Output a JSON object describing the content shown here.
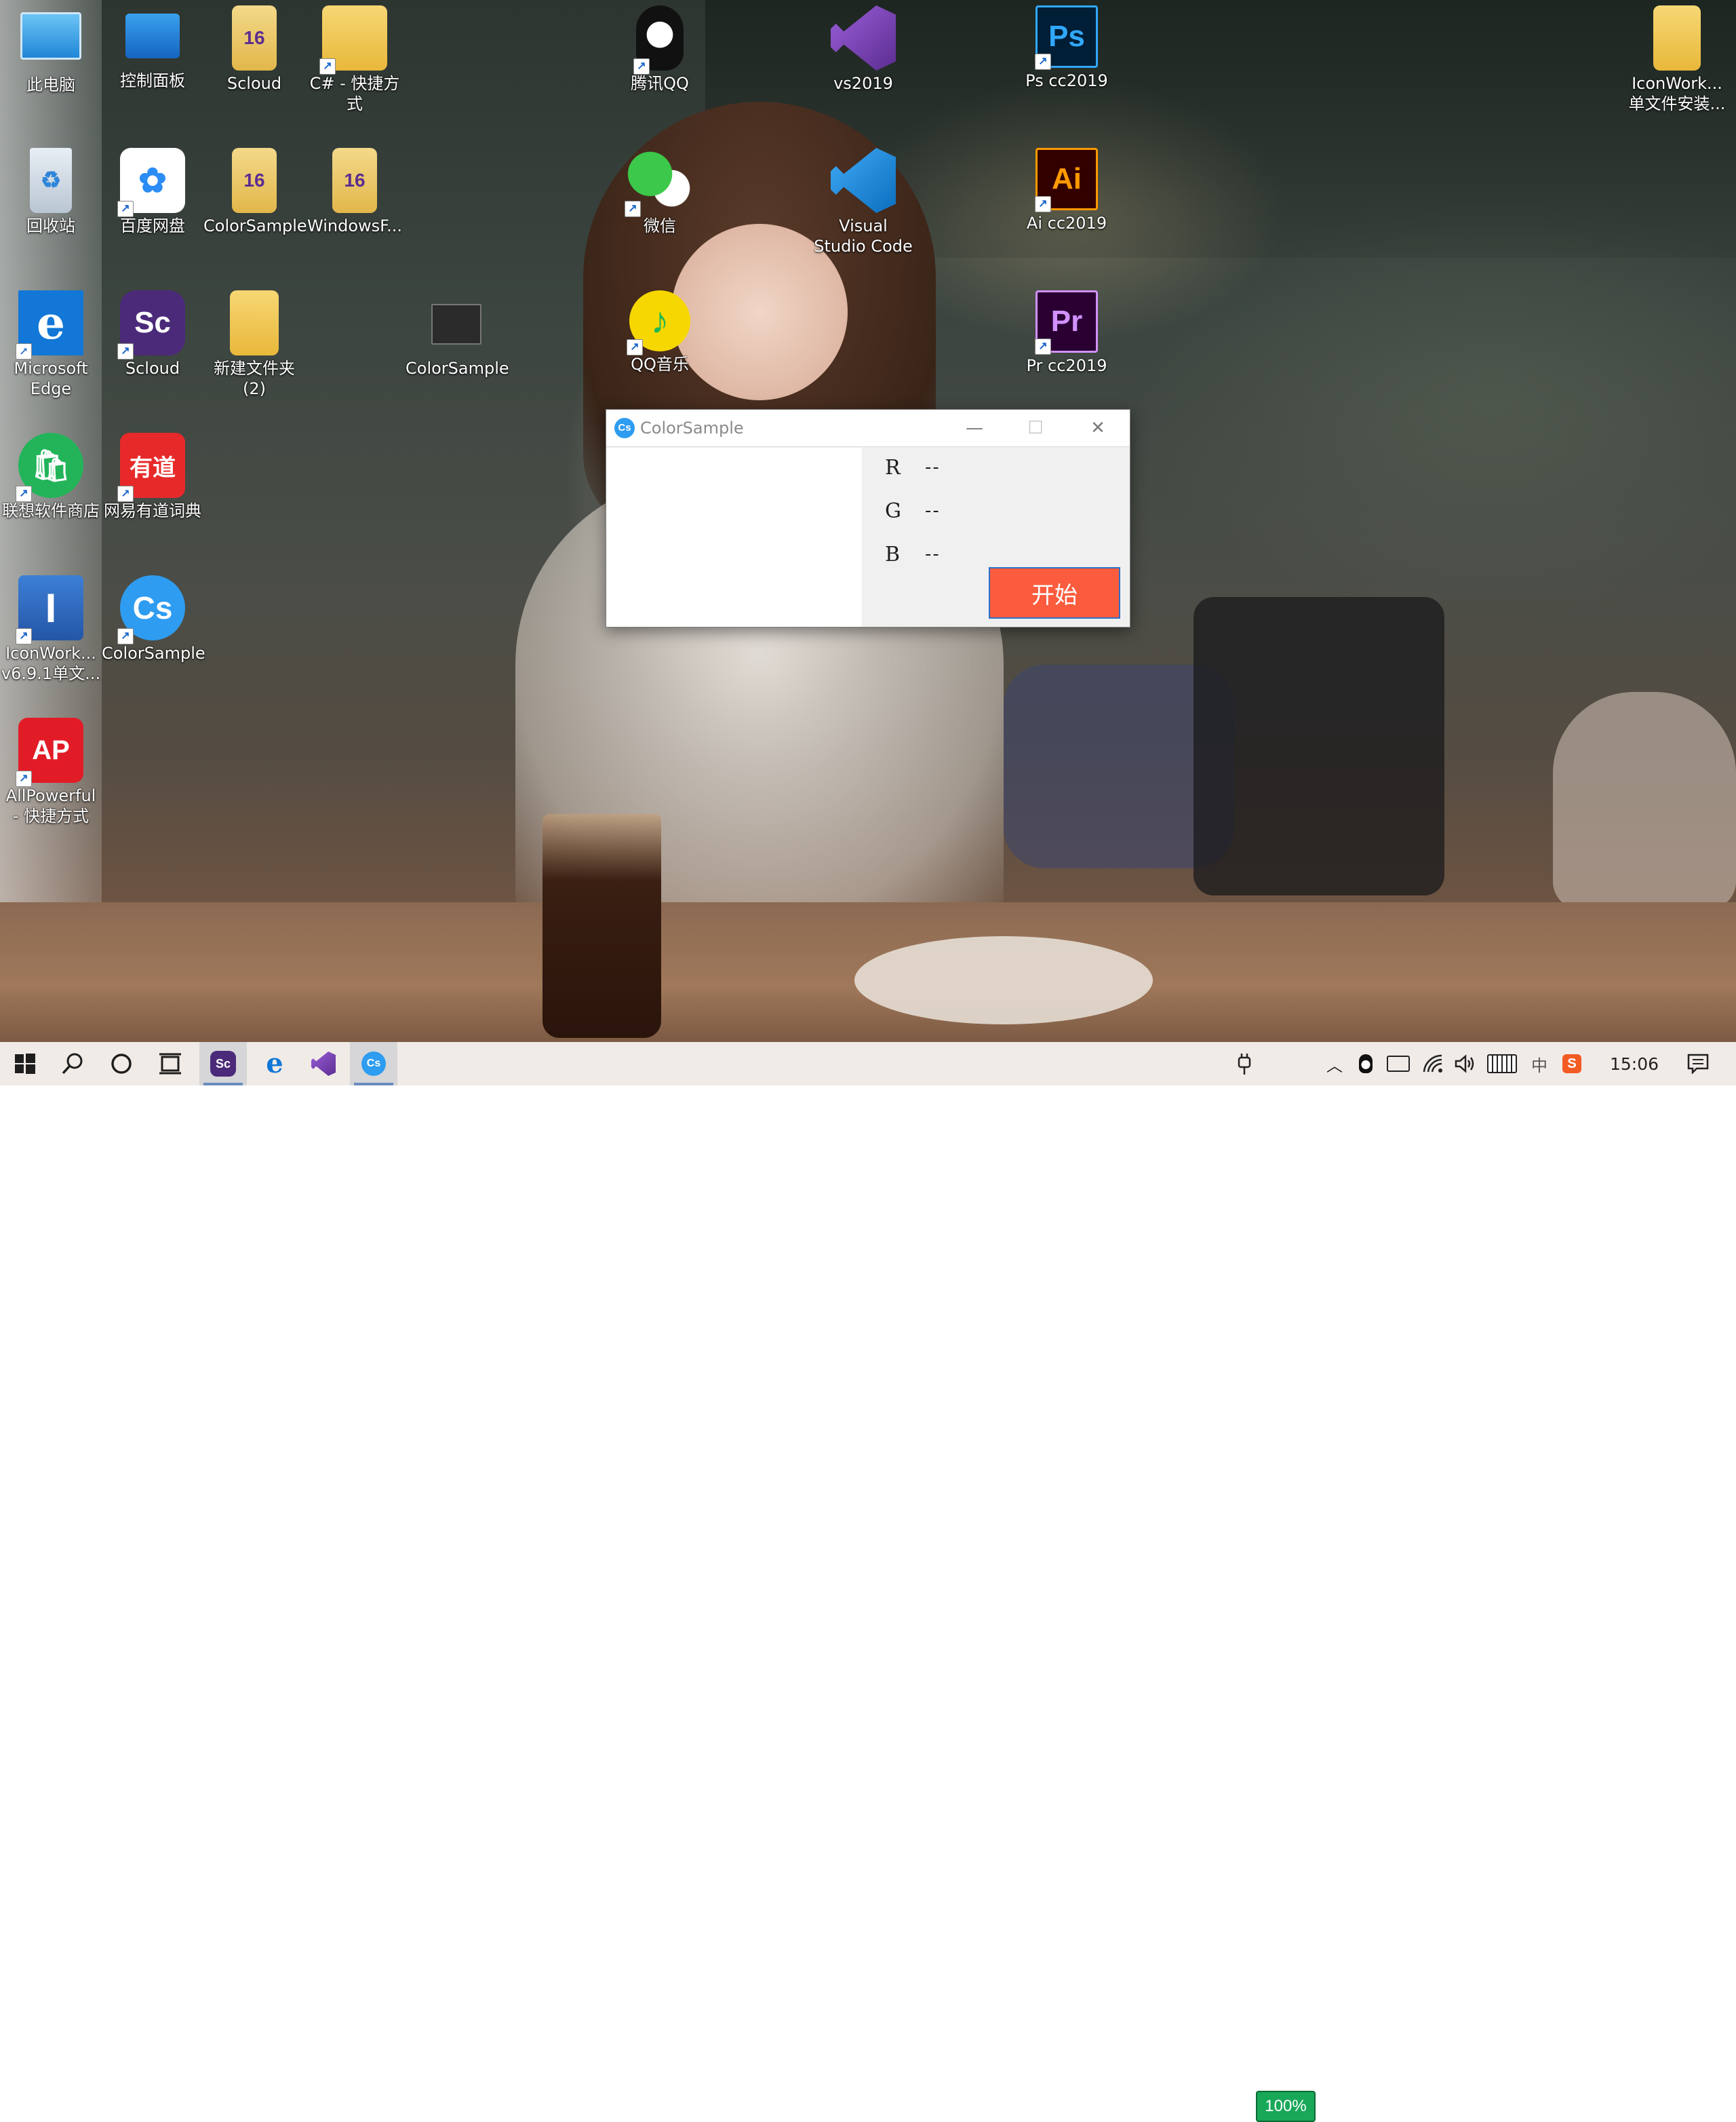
{
  "desktop_icons": [
    {
      "label": "此电脑",
      "icon": "this-pc-icon"
    },
    {
      "label": "控制面板",
      "icon": "control-panel-icon"
    },
    {
      "label": "Scloud",
      "icon": "vs-file-icon"
    },
    {
      "label": "C# - 快捷方\n式",
      "icon": "folder-icon"
    },
    {
      "label": "腾讯QQ",
      "icon": "qq-penguin-icon"
    },
    {
      "label": "vs2019",
      "icon": "visual-studio-icon"
    },
    {
      "label": "Ps cc2019",
      "icon": "photoshop-icon"
    },
    {
      "label": "IconWork...\n单文件安装...",
      "icon": "folder-icon"
    },
    {
      "label": "回收站",
      "icon": "recycle-bin-icon"
    },
    {
      "label": "百度网盘",
      "icon": "baidu-netdisk-icon"
    },
    {
      "label": "ColorSample",
      "icon": "vs-file-icon"
    },
    {
      "label": "WindowsF...",
      "icon": "vs-file-icon"
    },
    {
      "label": "微信",
      "icon": "wechat-icon"
    },
    {
      "label": "Visual\nStudio Code",
      "icon": "vscode-icon"
    },
    {
      "label": "Ai cc2019",
      "icon": "illustrator-icon"
    },
    {
      "label": "Microsoft\nEdge",
      "icon": "edge-icon"
    },
    {
      "label": "Scloud",
      "icon": "scloud-icon"
    },
    {
      "label": "新建文件夹\n(2)",
      "icon": "folder-icon"
    },
    {
      "label": "ColorSample",
      "icon": "app-window-icon"
    },
    {
      "label": "QQ音乐",
      "icon": "qq-music-icon"
    },
    {
      "label": "Pr cc2019",
      "icon": "premiere-icon"
    },
    {
      "label": "联想软件商店",
      "icon": "lenovo-store-icon"
    },
    {
      "label": "网易有道词典",
      "icon": "youdao-icon"
    },
    {
      "label": "IconWork...\nv6.9.1单文...",
      "icon": "iconworkshop-icon"
    },
    {
      "label": "ColorSample",
      "icon": "colorsample-icon"
    },
    {
      "label": "AllPowerful\n- 快捷方式",
      "icon": "allpowerful-icon"
    }
  ],
  "icon_glyphs": {
    "ps": "Ps",
    "ai": "Ai",
    "pr": "Pr",
    "sc": "Sc",
    "cs": "Cs",
    "ap": "AP",
    "edge": "e",
    "youdao": "有道",
    "vs16": "16"
  },
  "window": {
    "title": "ColorSample",
    "app_icon_text": "Cs",
    "minimize_glyph": "—",
    "maximize_glyph": "☐",
    "close_glyph": "✕",
    "channels": [
      {
        "label": "R",
        "value": "--"
      },
      {
        "label": "G",
        "value": "--"
      },
      {
        "label": "B",
        "value": "--"
      }
    ],
    "start_button_label": "开始"
  },
  "taskbar": {
    "pinned": [
      "start-icon",
      "search-icon",
      "cortana-icon",
      "task-view-icon",
      "scloud-icon",
      "edge-icon",
      "visual-studio-icon",
      "colorsample-icon"
    ],
    "battery_percent": "100%",
    "ime_indicator": "中",
    "clock": "15:06"
  },
  "colors": {
    "start_button": "#fb5c3e",
    "accent_blue": "#2e9cf0",
    "taskbar_bg": "#f1ebe7",
    "battery_green": "#18a858"
  }
}
